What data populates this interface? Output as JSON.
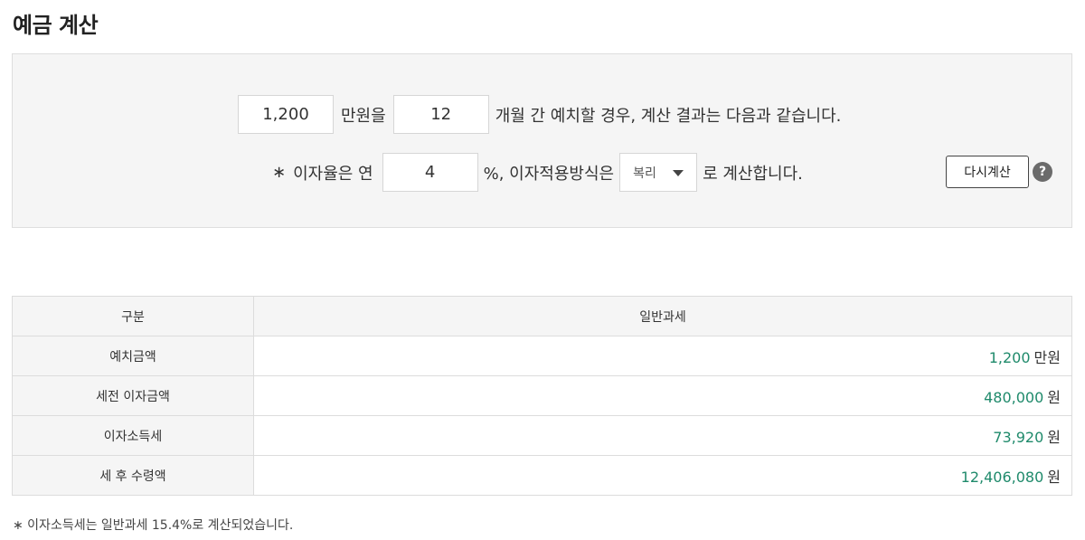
{
  "page_title": "예금 계산",
  "form": {
    "amount_value": "1,200",
    "amount_unit": "만원을",
    "months_value": "12",
    "months_suffix": "개월 간 예치할 경우, 계산 결과는 다음과 같습니다.",
    "star": "∗",
    "rate_prefix": "이자율은 연",
    "rate_value": "4",
    "rate_suffix": "%, 이자적용방식은",
    "method_selected": "복리",
    "method_suffix": "로 계산합니다.",
    "recalc_label": "다시계산",
    "help_symbol": "?"
  },
  "table": {
    "col_headers": [
      "구분",
      "일반과세"
    ],
    "rows": [
      {
        "label": "예치금액",
        "value": "1,200",
        "unit": "만원"
      },
      {
        "label": "세전 이자금액",
        "value": "480,000",
        "unit": "원"
      },
      {
        "label": "이자소득세",
        "value": "73,920",
        "unit": "원"
      },
      {
        "label": "세 후 수령액",
        "value": "12,406,080",
        "unit": "원"
      }
    ]
  },
  "footnote": "∗ 이자소득세는 일반과세 15.4%로 계산되었습니다.",
  "colors": {
    "value_green": "#1f8a6b",
    "panel_bg": "#f5f5f5",
    "border": "#dedede"
  }
}
